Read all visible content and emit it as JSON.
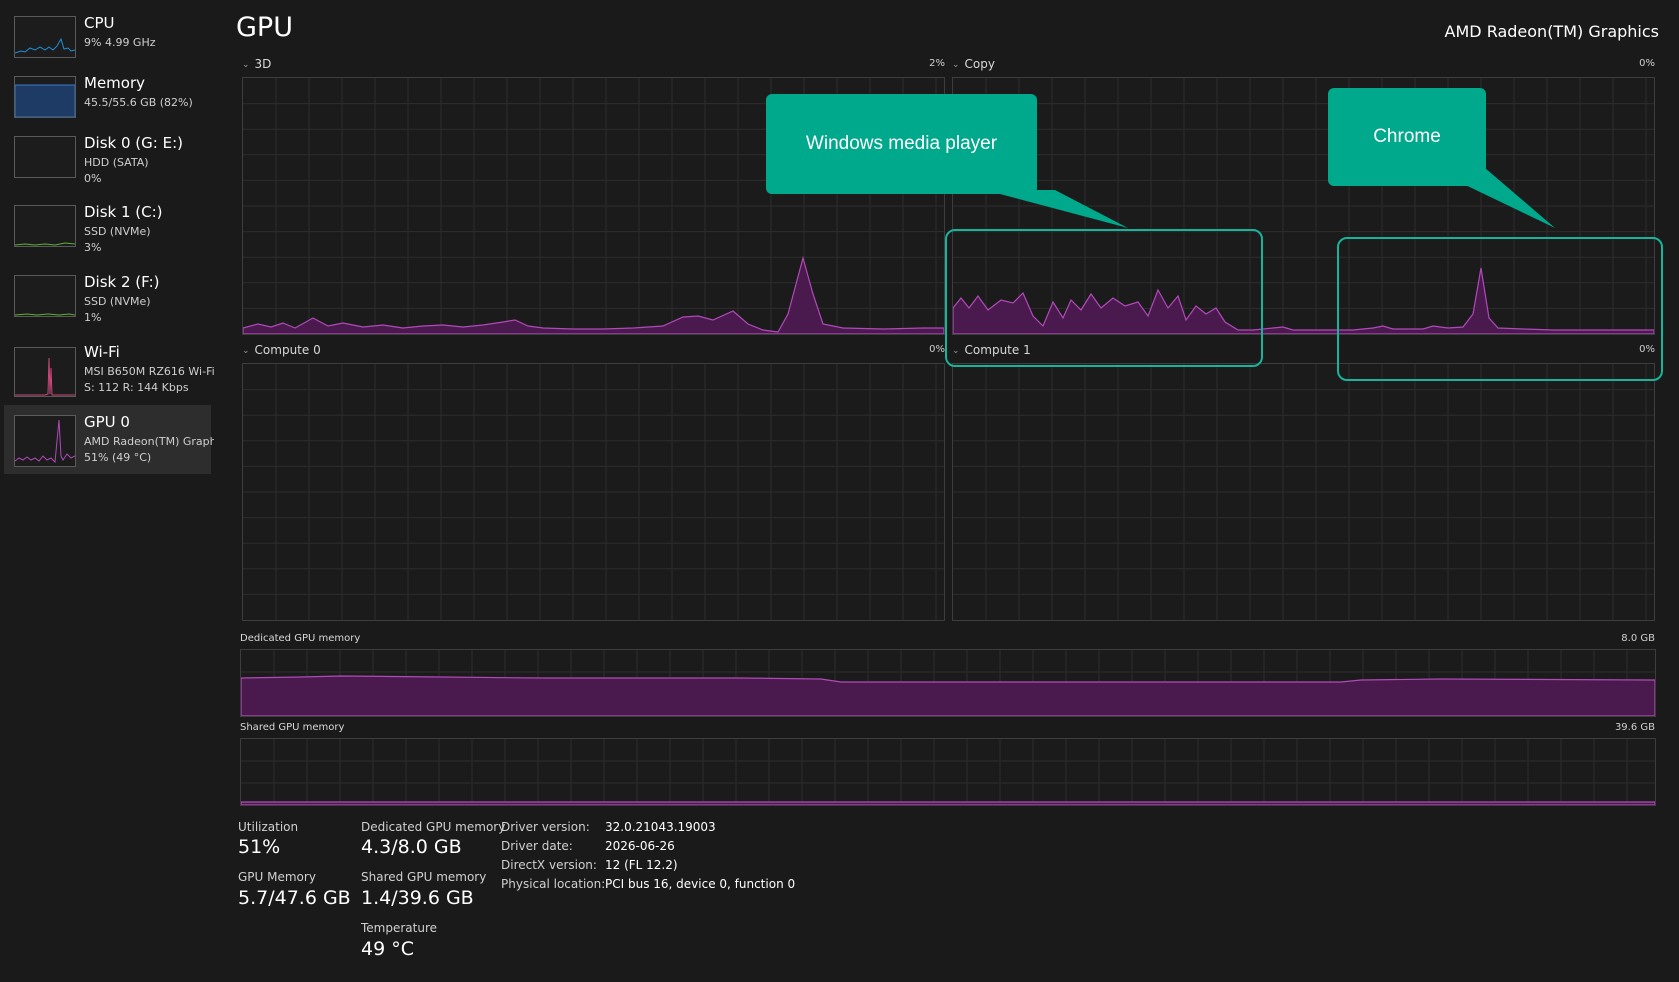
{
  "sidebar": {
    "items": [
      {
        "title": "CPU",
        "sub1": "9% 4.99 GHz",
        "sub2": "",
        "color": "#1e90d8"
      },
      {
        "title": "Memory",
        "sub1": "45.5/55.6 GB (82%)",
        "sub2": "",
        "color": "#3a78c8"
      },
      {
        "title": "Disk 0 (G: E:)",
        "sub1": "HDD (SATA)",
        "sub2": "0%",
        "color": "#5fae3a"
      },
      {
        "title": "Disk 1 (C:)",
        "sub1": "SSD (NVMe)",
        "sub2": "3%",
        "color": "#5fae3a"
      },
      {
        "title": "Disk 2 (F:)",
        "sub1": "SSD (NVMe)",
        "sub2": "1%",
        "color": "#5fae3a"
      },
      {
        "title": "Wi-Fi",
        "sub1": "MSI B650M RZ616 Wi-Fi",
        "sub2": "S: 112 R: 144 Kbps",
        "color": "#c8487a"
      },
      {
        "title": "GPU 0",
        "sub1": "AMD Radeon(TM) Graphics",
        "sub2": "51% (49 °C)",
        "color": "#b04ab8"
      }
    ],
    "selected_index": 6
  },
  "header": {
    "title": "GPU",
    "device": "AMD Radeon(TM) Graphics"
  },
  "engines": [
    {
      "label": "3D",
      "percent": "2%"
    },
    {
      "label": "Copy",
      "percent": "0%"
    },
    {
      "label": "Compute 0",
      "percent": "0%"
    },
    {
      "label": "Compute 1",
      "percent": "0%"
    }
  ],
  "memory_graphs": {
    "dedicated": {
      "label": "Dedicated GPU memory",
      "max": "8.0 GB",
      "level": 0.54
    },
    "shared": {
      "label": "Shared GPU memory",
      "max": "39.6 GB",
      "level": 0.035
    }
  },
  "stats": {
    "utilization_label": "Utilization",
    "utilization": "51%",
    "dedicated_label": "Dedicated GPU memory",
    "dedicated": "4.3/8.0 GB",
    "gpu_memory_label": "GPU Memory",
    "gpu_memory": "5.7/47.6 GB",
    "shared_label": "Shared GPU memory",
    "shared": "1.4/39.6 GB",
    "temperature_label": "Temperature",
    "temperature": "49 °C"
  },
  "info": [
    {
      "key": "Driver version:",
      "value": "32.0.21043.19003"
    },
    {
      "key": "Driver date:",
      "value": "2026-06-26"
    },
    {
      "key": "DirectX version:",
      "value": "12 (FL 12.2)"
    },
    {
      "key": "Physical location:",
      "value": "PCI bus 16, device 0, function 0"
    }
  ],
  "callouts": {
    "wmp": "Windows media player",
    "chrome": "Chrome",
    "color": "#00a88c"
  },
  "colors": {
    "gpu_line": "#b04ab8",
    "gpu_fill": "#4a1a4e",
    "grid": "#2c2c2c"
  }
}
